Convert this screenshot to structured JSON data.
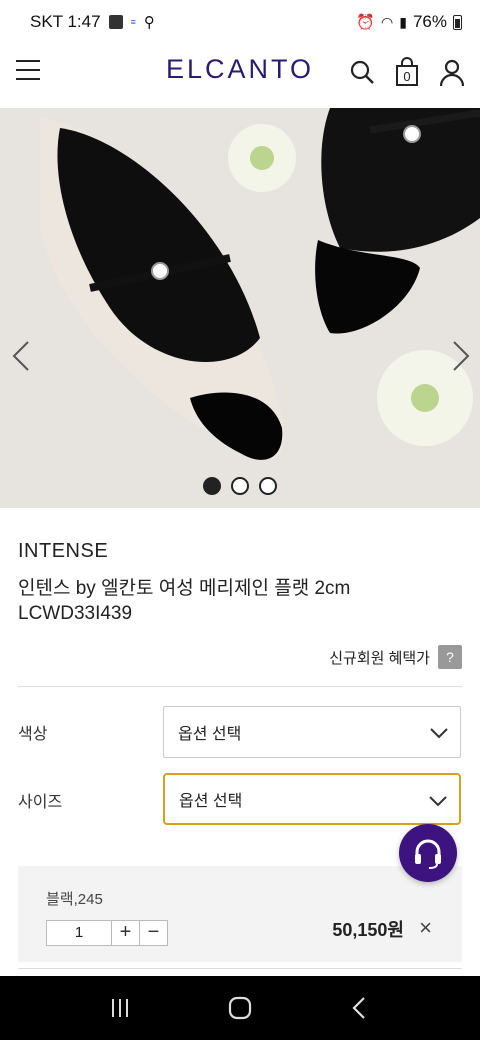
{
  "status_bar": {
    "carrier_time": "SKT 1:47",
    "battery": "76%"
  },
  "header": {
    "logo": "ELCANTO",
    "cart_count": "0"
  },
  "hero": {
    "image_description": "product photo of black mary-jane flats",
    "carousel_count": 3,
    "active_index": 0
  },
  "product": {
    "brand": "INTENSE",
    "name": "인텐스 by 엘칸토 여성 메리제인 플랫 2cm LCWD33I439",
    "benefit_label": "신규회원 혜택가",
    "benefit_help": "?"
  },
  "options": [
    {
      "label": "색상",
      "value": "옵션 선택"
    },
    {
      "label": "사이즈",
      "value": "옵션 선택"
    }
  ],
  "selected_item": {
    "name": "블랙,245",
    "quantity": "1",
    "plus": "+",
    "minus": "−",
    "price": "50,150원",
    "remove": "×"
  },
  "colors": {
    "brand": "#2b1a70",
    "fab": "#3d1380",
    "focus_border": "#d6a21a"
  }
}
